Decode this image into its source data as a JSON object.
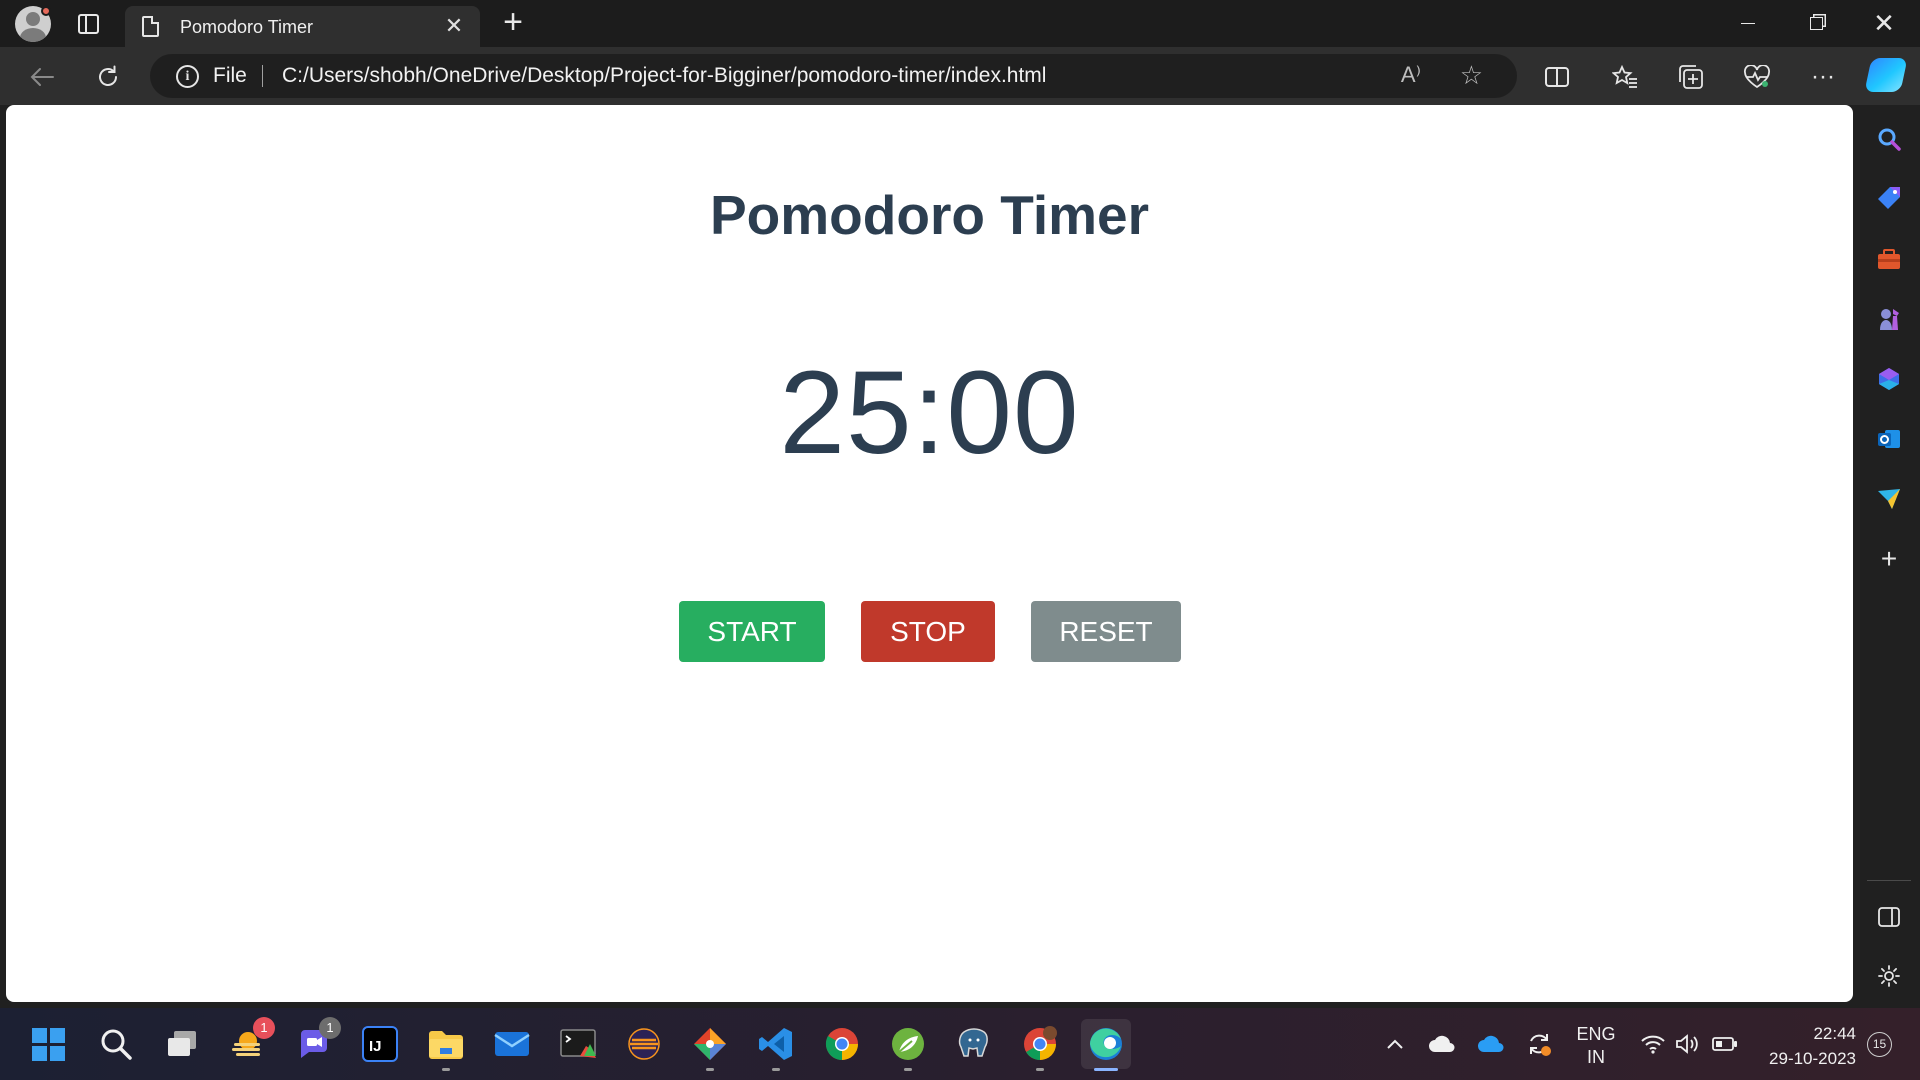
{
  "browser": {
    "tab_title": "Pomodoro Timer",
    "close_tab_glyph": "✕",
    "new_tab_glyph": "+",
    "address": {
      "scheme_label": "File",
      "url": "C:/Users/shobh/OneDrive/Desktop/Project-for-Bigginer/pomodoro-timer/index.html",
      "read_aloud_glyph": "A⁾"
    }
  },
  "page": {
    "title": "Pomodoro Timer",
    "timer": "25:00",
    "buttons": {
      "start": "START",
      "stop": "STOP",
      "reset": "RESET"
    },
    "colors": {
      "heading": "#2c3e50",
      "start": "#27ae60",
      "stop": "#c0392b",
      "reset": "#7f8c8d"
    }
  },
  "sidebar": {
    "items": [
      "search-icon",
      "shopping-tag-icon",
      "tools-icon",
      "games-icon",
      "copilot-icon",
      "outlook-icon",
      "drop-icon",
      "add-icon",
      "sidebar-toggle-icon",
      "settings-icon"
    ]
  },
  "taskbar": {
    "apps": [
      {
        "name": "start",
        "badge": ""
      },
      {
        "name": "search",
        "badge": ""
      },
      {
        "name": "task-view",
        "badge": ""
      },
      {
        "name": "widgets",
        "badge": "1"
      },
      {
        "name": "teams-chat",
        "badge": "1"
      },
      {
        "name": "intellij",
        "label": "IJ",
        "badge": ""
      },
      {
        "name": "file-explorer",
        "badge": ""
      },
      {
        "name": "mail",
        "badge": ""
      },
      {
        "name": "terminal",
        "badge": ""
      },
      {
        "name": "eclipse",
        "badge": ""
      },
      {
        "name": "git",
        "badge": ""
      },
      {
        "name": "vscode",
        "badge": ""
      },
      {
        "name": "chrome",
        "badge": ""
      },
      {
        "name": "spring",
        "badge": ""
      },
      {
        "name": "postgresql",
        "badge": ""
      },
      {
        "name": "chrome-profile",
        "badge": ""
      },
      {
        "name": "edge",
        "badge": ""
      }
    ],
    "tray": {
      "lang_top": "ENG",
      "lang_bottom": "IN",
      "time": "22:44",
      "date": "29-10-2023",
      "notifications": "15"
    }
  }
}
